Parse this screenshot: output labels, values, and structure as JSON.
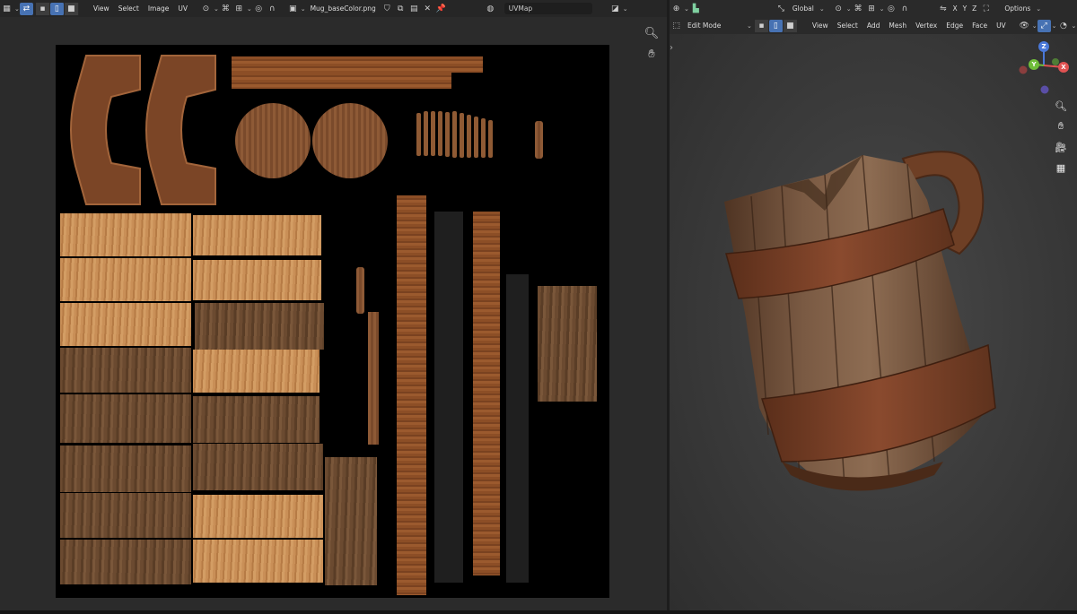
{
  "uv_editor": {
    "menus": [
      "View",
      "Select",
      "Image",
      "UV"
    ],
    "image_name": "Mug_baseColor.png",
    "uv_map": "UVMap"
  },
  "viewport": {
    "orientation": "Global",
    "axis_labels": [
      "X",
      "Y",
      "Z"
    ],
    "options_label": "Options",
    "mode": "Edit Mode",
    "menus": [
      "View",
      "Select",
      "Add",
      "Mesh",
      "Vertex",
      "Edge",
      "Face",
      "UV"
    ],
    "gizmo": {
      "x": "X",
      "y": "Y",
      "z": "Z"
    }
  },
  "colors": {
    "accent": "#4772b3",
    "x_axis": "#e05252",
    "y_axis": "#6fbd3a",
    "z_axis": "#4a78d8"
  }
}
